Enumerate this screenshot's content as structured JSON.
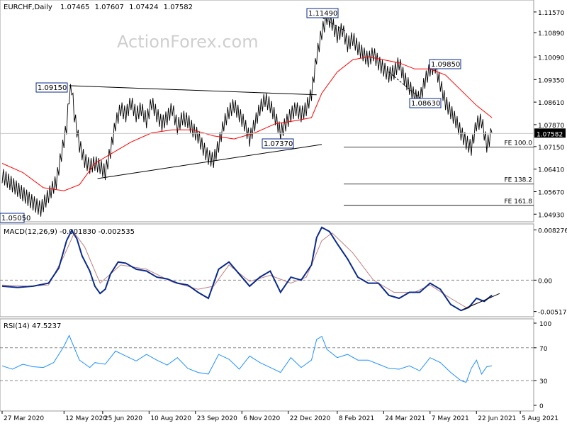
{
  "chart_data": {
    "type": "line",
    "main": {
      "symbol_line": {
        "symbol": "EURCHF,Daily",
        "ohlc": [
          "1.07465",
          "1.07607",
          "1.07424",
          "1.07582"
        ]
      },
      "last_price": "1.07582",
      "y_ticks": [
        "1.11570",
        "1.10890",
        "1.10090",
        "1.09350",
        "1.08610",
        "1.07870",
        "1.07150",
        "1.06410",
        "1.05670",
        "1.04930"
      ],
      "y_range": [
        1.0475,
        1.1187
      ],
      "levels": {
        "fe100": 1.0713,
        "fe138": 1.0592,
        "fe161": 1.0522
      },
      "level_labels": [
        "FE 100.0",
        "FE 138.2",
        "FE 161.8"
      ],
      "annotations": [
        "1.11490",
        "1.09150",
        "1.07370",
        "1.08630",
        "1.09850",
        "1.05050"
      ],
      "ma_label": "",
      "price_path": [
        [
          0,
          1.062
        ],
        [
          4,
          1.059
        ],
        [
          8,
          1.056
        ],
        [
          12,
          1.053
        ],
        [
          15,
          1.051
        ],
        [
          17,
          1.054
        ],
        [
          19,
          1.057
        ],
        [
          21,
          1.06
        ],
        [
          23,
          1.069
        ],
        [
          25,
          1.078
        ],
        [
          26,
          1.088
        ],
        [
          27,
          1.091
        ],
        [
          28,
          1.082
        ],
        [
          30,
          1.072
        ],
        [
          32,
          1.067
        ],
        [
          34,
          1.065
        ],
        [
          36,
          1.066
        ],
        [
          38,
          1.065
        ],
        [
          40,
          1.063
        ],
        [
          42,
          1.07
        ],
        [
          44,
          1.079
        ],
        [
          46,
          1.084
        ],
        [
          48,
          1.082
        ],
        [
          50,
          1.086
        ],
        [
          52,
          1.082
        ],
        [
          54,
          1.084
        ],
        [
          56,
          1.08
        ],
        [
          58,
          1.086
        ],
        [
          60,
          1.082
        ],
        [
          62,
          1.079
        ],
        [
          64,
          1.081
        ],
        [
          66,
          1.084
        ],
        [
          68,
          1.078
        ],
        [
          70,
          1.081
        ],
        [
          72,
          1.08
        ],
        [
          74,
          1.077
        ],
        [
          76,
          1.075
        ],
        [
          78,
          1.071
        ],
        [
          80,
          1.068
        ],
        [
          82,
          1.067
        ],
        [
          84,
          1.072
        ],
        [
          86,
          1.079
        ],
        [
          88,
          1.083
        ],
        [
          90,
          1.085
        ],
        [
          92,
          1.082
        ],
        [
          94,
          1.079
        ],
        [
          96,
          1.074
        ],
        [
          98,
          1.079
        ],
        [
          100,
          1.084
        ],
        [
          102,
          1.087
        ],
        [
          104,
          1.085
        ],
        [
          106,
          1.081
        ],
        [
          108,
          1.076
        ],
        [
          110,
          1.079
        ],
        [
          112,
          1.082
        ],
        [
          114,
          1.084
        ],
        [
          116,
          1.082
        ],
        [
          118,
          1.084
        ],
        [
          120,
          1.089
        ],
        [
          122,
          1.101
        ],
        [
          124,
          1.109
        ],
        [
          126,
          1.114
        ],
        [
          128,
          1.112
        ],
        [
          130,
          1.108
        ],
        [
          132,
          1.11
        ],
        [
          134,
          1.105
        ],
        [
          136,
          1.107
        ],
        [
          138,
          1.104
        ],
        [
          140,
          1.102
        ],
        [
          142,
          1.1
        ],
        [
          144,
          1.102
        ],
        [
          146,
          1.099
        ],
        [
          148,
          1.097
        ],
        [
          150,
          1.095
        ],
        [
          152,
          1.096
        ],
        [
          154,
          1.099
        ],
        [
          156,
          1.094
        ],
        [
          158,
          1.091
        ],
        [
          160,
          1.088
        ],
        [
          162,
          1.087
        ],
        [
          164,
          1.093
        ],
        [
          166,
          1.097
        ],
        [
          168,
          1.098
        ],
        [
          170,
          1.092
        ],
        [
          172,
          1.086
        ],
        [
          174,
          1.083
        ],
        [
          176,
          1.08
        ],
        [
          178,
          1.076
        ],
        [
          180,
          1.073
        ],
        [
          182,
          1.071
        ],
        [
          184,
          1.079
        ],
        [
          186,
          1.08
        ],
        [
          188,
          1.072
        ],
        [
          190,
          1.076
        ]
      ],
      "ma_path": [
        [
          0,
          1.066
        ],
        [
          8,
          1.063
        ],
        [
          16,
          1.058
        ],
        [
          24,
          1.057
        ],
        [
          30,
          1.059
        ],
        [
          36,
          1.066
        ],
        [
          42,
          1.069
        ],
        [
          50,
          1.073
        ],
        [
          58,
          1.076
        ],
        [
          66,
          1.077
        ],
        [
          74,
          1.077
        ],
        [
          82,
          1.075
        ],
        [
          90,
          1.074
        ],
        [
          98,
          1.076
        ],
        [
          106,
          1.079
        ],
        [
          114,
          1.08
        ],
        [
          120,
          1.081
        ],
        [
          124,
          1.089
        ],
        [
          130,
          1.096
        ],
        [
          136,
          1.1
        ],
        [
          142,
          1.101
        ],
        [
          148,
          1.1
        ],
        [
          154,
          1.099
        ],
        [
          160,
          1.097
        ],
        [
          166,
          1.097
        ],
        [
          172,
          1.095
        ],
        [
          178,
          1.09
        ],
        [
          184,
          1.085
        ],
        [
          190,
          1.081
        ]
      ],
      "trendlines": [
        {
          "name": "upper",
          "from": [
            26,
            1.0915
          ],
          "to": [
            122,
            1.0885
          ]
        },
        {
          "name": "lower",
          "from": [
            37,
            1.061
          ],
          "to": [
            124,
            1.0722
          ]
        },
        {
          "name": "decline-1",
          "from": [
            122,
            1.1149
          ],
          "to": [
            133,
            1.1095
          ]
        },
        {
          "name": "decline-2",
          "from": [
            150,
            1.096
          ],
          "to": [
            162,
            1.0875
          ]
        },
        {
          "name": "macd-trend",
          "from": [
            179,
            -0.0048
          ],
          "to": [
            193,
            -0.0022
          ]
        }
      ]
    },
    "macd": {
      "label": "MACD(12,26,9) -0.001830 -0.002535",
      "y_ticks": [
        "0.008276",
        "0.00",
        "-0.005174"
      ],
      "y_range": [
        -0.0058,
        0.0088
      ],
      "macd_path": [
        [
          0,
          -0.001
        ],
        [
          6,
          -0.0012
        ],
        [
          12,
          -0.001
        ],
        [
          18,
          -0.0005
        ],
        [
          22,
          0.002
        ],
        [
          25,
          0.0065
        ],
        [
          27,
          0.0082
        ],
        [
          29,
          0.0068
        ],
        [
          31,
          0.004
        ],
        [
          34,
          0.0015
        ],
        [
          36,
          -0.001
        ],
        [
          38,
          -0.0022
        ],
        [
          40,
          -0.0015
        ],
        [
          42,
          0.001
        ],
        [
          45,
          0.003
        ],
        [
          48,
          0.0028
        ],
        [
          52,
          0.0018
        ],
        [
          56,
          0.0015
        ],
        [
          60,
          0.0005
        ],
        [
          64,
          0.0002
        ],
        [
          68,
          -0.0005
        ],
        [
          72,
          -0.0008
        ],
        [
          76,
          -0.002
        ],
        [
          80,
          -0.003
        ],
        [
          84,
          0.0018
        ],
        [
          88,
          0.003
        ],
        [
          92,
          0.001
        ],
        [
          96,
          -0.001
        ],
        [
          100,
          0.0005
        ],
        [
          104,
          0.0015
        ],
        [
          108,
          -0.002
        ],
        [
          112,
          0.0005
        ],
        [
          116,
          0.0
        ],
        [
          120,
          0.0025
        ],
        [
          122,
          0.007
        ],
        [
          124,
          0.0087
        ],
        [
          127,
          0.008
        ],
        [
          130,
          0.006
        ],
        [
          134,
          0.0035
        ],
        [
          138,
          0.0005
        ],
        [
          142,
          -0.0005
        ],
        [
          146,
          -0.0005
        ],
        [
          150,
          -0.0025
        ],
        [
          154,
          -0.003
        ],
        [
          158,
          -0.002
        ],
        [
          162,
          -0.002
        ],
        [
          166,
          -0.0005
        ],
        [
          170,
          -0.0015
        ],
        [
          174,
          -0.004
        ],
        [
          178,
          -0.005
        ],
        [
          181,
          -0.0045
        ],
        [
          184,
          -0.003
        ],
        [
          187,
          -0.0035
        ],
        [
          190,
          -0.0025
        ]
      ],
      "signal_path": [
        [
          0,
          -0.0008
        ],
        [
          10,
          -0.001
        ],
        [
          18,
          -0.0008
        ],
        [
          24,
          0.004
        ],
        [
          28,
          0.0078
        ],
        [
          32,
          0.0055
        ],
        [
          38,
          -0.0005
        ],
        [
          46,
          0.0025
        ],
        [
          56,
          0.0018
        ],
        [
          66,
          -0.0003
        ],
        [
          76,
          -0.0015
        ],
        [
          82,
          -0.001
        ],
        [
          88,
          0.0025
        ],
        [
          96,
          -0.0002
        ],
        [
          104,
          0.0008
        ],
        [
          112,
          -0.0005
        ],
        [
          118,
          0.0005
        ],
        [
          124,
          0.0065
        ],
        [
          128,
          0.0078
        ],
        [
          136,
          0.0045
        ],
        [
          144,
          0.0
        ],
        [
          152,
          -0.002
        ],
        [
          160,
          -0.002
        ],
        [
          166,
          -0.0008
        ],
        [
          174,
          -0.003
        ],
        [
          180,
          -0.0045
        ],
        [
          186,
          -0.0035
        ],
        [
          190,
          -0.0028
        ]
      ]
    },
    "rsi": {
      "label": "RSI(14) 47.5237",
      "y_ticks": [
        "100",
        "70",
        "30",
        "0"
      ],
      "y_range": [
        0,
        100
      ],
      "rsi_path": [
        [
          0,
          48
        ],
        [
          4,
          44
        ],
        [
          8,
          50
        ],
        [
          12,
          47
        ],
        [
          16,
          46
        ],
        [
          20,
          52
        ],
        [
          24,
          72
        ],
        [
          26,
          85
        ],
        [
          28,
          70
        ],
        [
          30,
          55
        ],
        [
          34,
          46
        ],
        [
          36,
          52
        ],
        [
          40,
          50
        ],
        [
          44,
          66
        ],
        [
          48,
          60
        ],
        [
          52,
          54
        ],
        [
          56,
          62
        ],
        [
          60,
          55
        ],
        [
          64,
          49
        ],
        [
          68,
          58
        ],
        [
          72,
          45
        ],
        [
          76,
          40
        ],
        [
          80,
          38
        ],
        [
          84,
          62
        ],
        [
          88,
          56
        ],
        [
          92,
          44
        ],
        [
          96,
          60
        ],
        [
          100,
          52
        ],
        [
          104,
          46
        ],
        [
          108,
          40
        ],
        [
          112,
          58
        ],
        [
          116,
          46
        ],
        [
          120,
          55
        ],
        [
          122,
          80
        ],
        [
          124,
          84
        ],
        [
          126,
          68
        ],
        [
          130,
          58
        ],
        [
          134,
          62
        ],
        [
          138,
          55
        ],
        [
          142,
          55
        ],
        [
          146,
          50
        ],
        [
          150,
          45
        ],
        [
          154,
          44
        ],
        [
          158,
          48
        ],
        [
          162,
          42
        ],
        [
          166,
          58
        ],
        [
          170,
          52
        ],
        [
          174,
          40
        ],
        [
          178,
          30
        ],
        [
          180,
          28
        ],
        [
          182,
          45
        ],
        [
          184,
          55
        ],
        [
          186,
          38
        ],
        [
          188,
          47
        ],
        [
          190,
          48
        ]
      ]
    },
    "x_ticks": [
      {
        "label": "27 Mar 2020",
        "i": 0
      },
      {
        "label": "12 May 2020",
        "i": 24
      },
      {
        "label": "25 Jun 2020",
        "i": 39
      },
      {
        "label": "10 Aug 2020",
        "i": 57
      },
      {
        "label": "23 Sep 2020",
        "i": 75
      },
      {
        "label": "6 Nov 2020",
        "i": 93
      },
      {
        "label": "22 Dec 2020",
        "i": 111
      },
      {
        "label": "8 Feb 2021",
        "i": 130
      },
      {
        "label": "24 Mar 2021",
        "i": 148
      },
      {
        "label": "7 May 2021",
        "i": 166
      },
      {
        "label": "22 Jun 2021",
        "i": 184
      },
      {
        "label": "5 Aug 2021",
        "i": 201
      }
    ]
  },
  "watermark": "ActionForex.com",
  "colors": {
    "price": "#000000",
    "ma": "#ff0000",
    "macd": "#0a2a8c",
    "signal": "#c08080",
    "rsi": "#1e90ff",
    "label_border": "#0a2a8c",
    "last_price_bg": "#000000"
  }
}
